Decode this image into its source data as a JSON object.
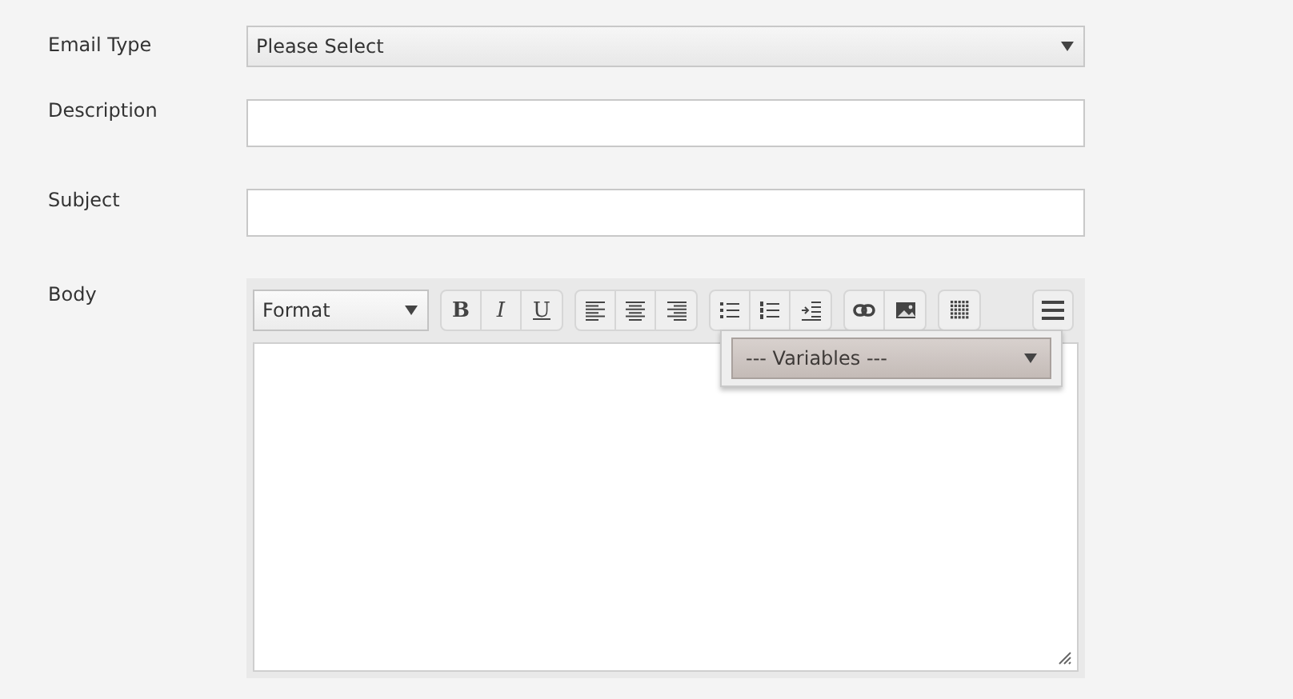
{
  "fields": [
    {
      "kind": "select",
      "label": "Email Type",
      "value": "Please Select"
    },
    {
      "kind": "text",
      "label": "Description"
    },
    {
      "kind": "text",
      "label": "Subject"
    }
  ],
  "body": {
    "label": "Body",
    "format_select": {
      "value": "Format"
    },
    "toolbar_groups": [
      [
        {
          "kind": "bold",
          "text": "B"
        },
        {
          "kind": "italic",
          "text": "I"
        },
        {
          "kind": "underline",
          "text": "U"
        }
      ],
      [
        {
          "kind": "align-left"
        },
        {
          "kind": "align-center"
        },
        {
          "kind": "align-right"
        }
      ],
      [
        {
          "kind": "bullet-list"
        },
        {
          "kind": "numbered-list"
        },
        {
          "kind": "indent"
        }
      ],
      [
        {
          "kind": "link"
        },
        {
          "kind": "image"
        }
      ],
      [
        {
          "kind": "table"
        }
      ]
    ],
    "variables_select": {
      "value": "--- Variables ---"
    }
  }
}
